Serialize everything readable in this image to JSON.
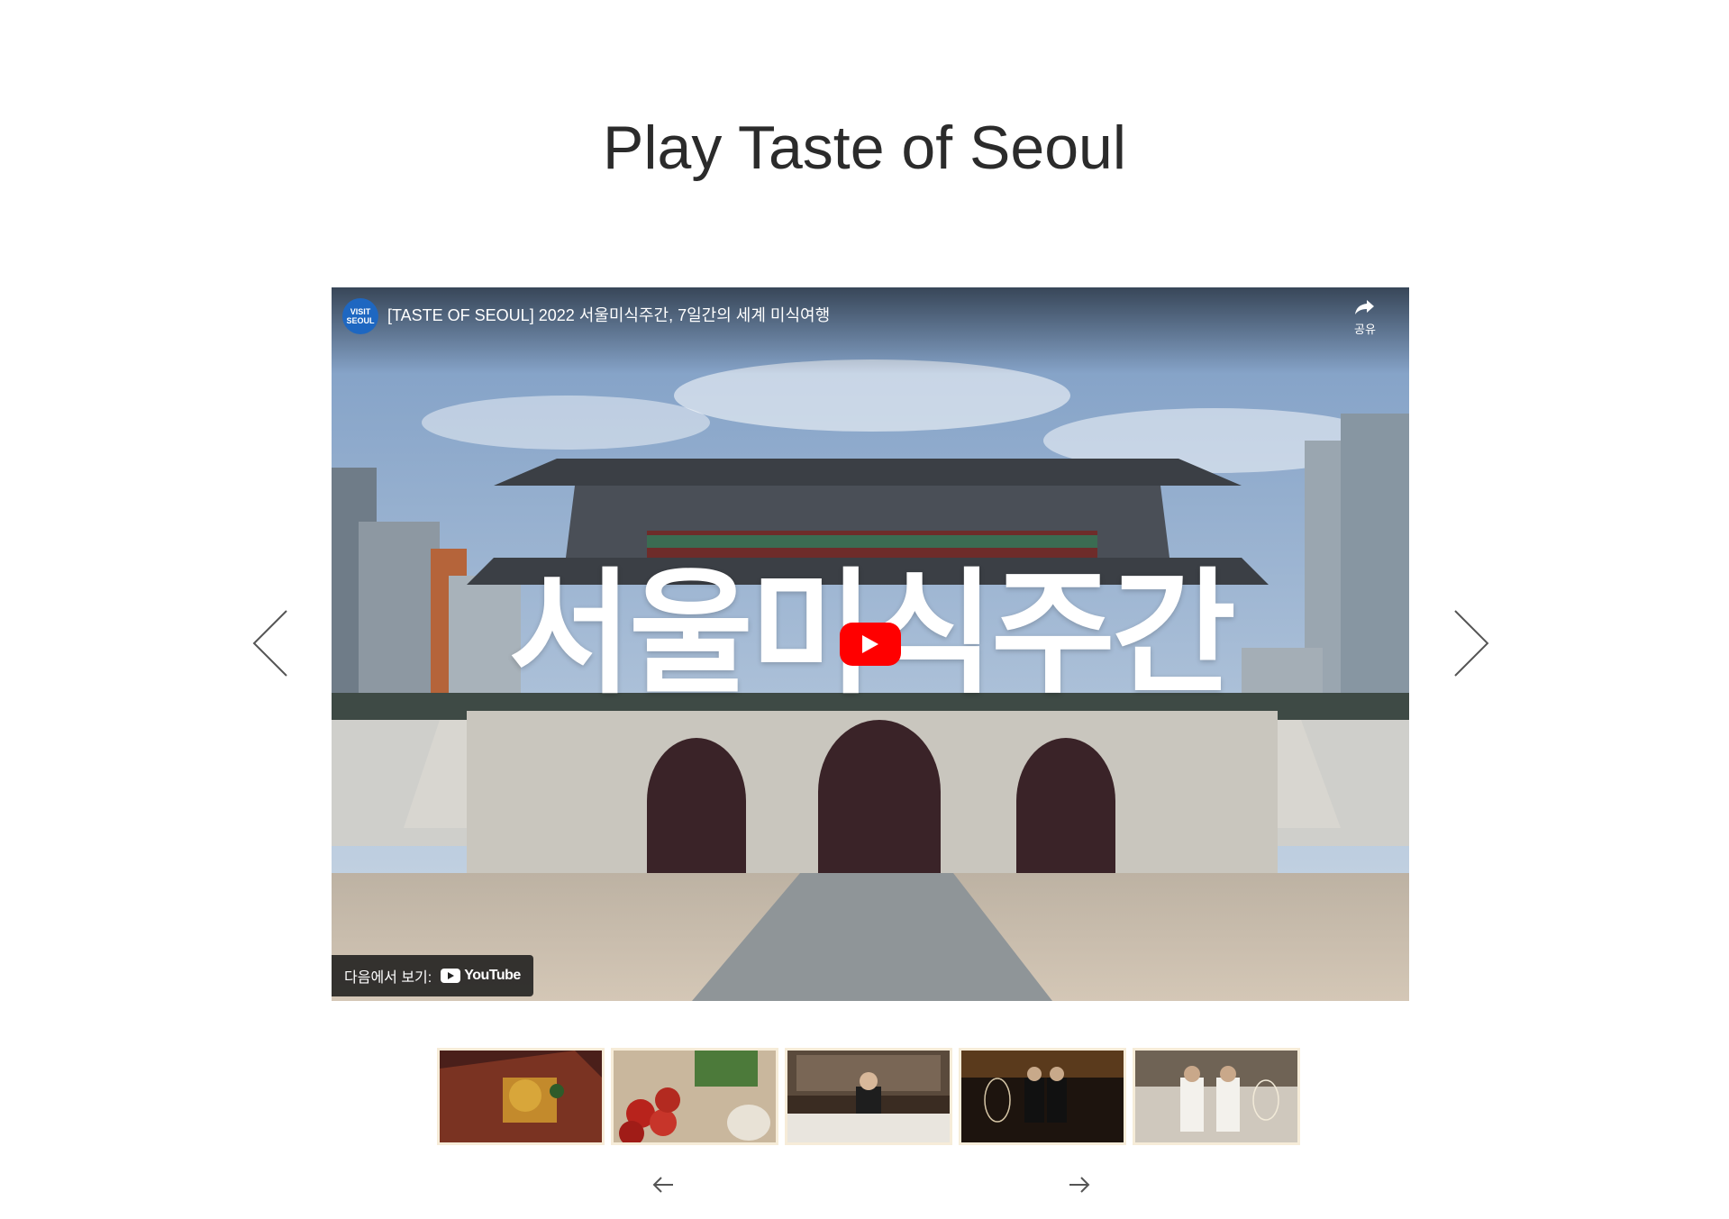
{
  "page": {
    "title": "Play Taste of Seoul"
  },
  "player": {
    "channel_logo_text": "VISIT SEOUL",
    "video_title": "[TASTE OF SEOUL] 2022 서울미식주간, 7일간의 세계 미식여행",
    "share_label": "공유",
    "overlay_text": "서울미식주간",
    "watch_on_label": "다음에서 보기:",
    "youtube_label": "YouTube",
    "play_button_color": "#ff0000"
  },
  "carousel": {
    "prev_icon": "chevron-left-icon",
    "next_icon": "chevron-right-icon"
  },
  "thumbnails": {
    "items": [
      {
        "name": "thumb-1"
      },
      {
        "name": "thumb-2"
      },
      {
        "name": "thumb-3"
      },
      {
        "name": "thumb-4"
      },
      {
        "name": "thumb-5"
      }
    ],
    "prev_icon": "arrow-left-icon",
    "next_icon": "arrow-right-icon"
  },
  "colors": {
    "title": "#2b2b2b",
    "thumb_border": "#f6ecd8",
    "arrow": "#555555"
  }
}
